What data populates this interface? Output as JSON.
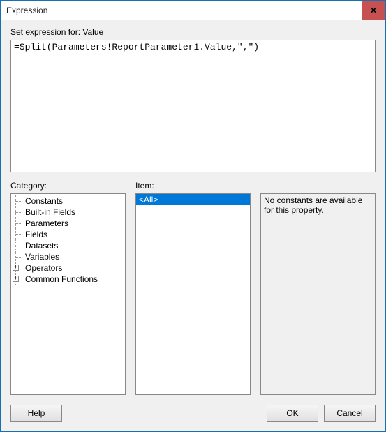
{
  "window": {
    "title": "Expression",
    "close_glyph": "✕"
  },
  "labels": {
    "set_expression_for": "Set expression for: Value",
    "category": "Category:",
    "item": "Item:"
  },
  "expression": {
    "value": "=Split(Parameters!ReportParameter1.Value,\",\")"
  },
  "category_tree": {
    "items": [
      {
        "label": "Constants",
        "type": "leaf"
      },
      {
        "label": "Built-in Fields",
        "type": "leaf"
      },
      {
        "label": "Parameters",
        "type": "leaf"
      },
      {
        "label": "Fields",
        "type": "leaf"
      },
      {
        "label": "Datasets",
        "type": "leaf"
      },
      {
        "label": "Variables",
        "type": "leaf"
      },
      {
        "label": "Operators",
        "type": "expand"
      },
      {
        "label": "Common Functions",
        "type": "expand"
      }
    ]
  },
  "item_list": {
    "items": [
      {
        "label": "<All>",
        "selected": true
      }
    ]
  },
  "description": {
    "text": "No constants are available for this property."
  },
  "buttons": {
    "help": "Help",
    "ok": "OK",
    "cancel": "Cancel"
  }
}
